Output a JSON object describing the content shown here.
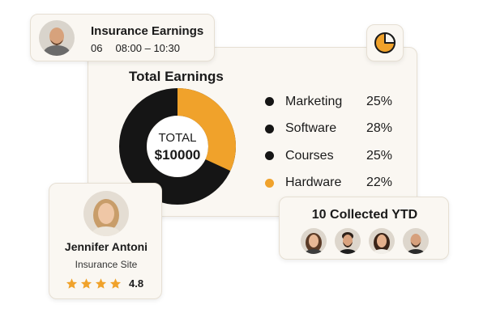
{
  "insurance_card": {
    "title": "Insurance Earnings",
    "day": "06",
    "time": "08:00 – 10:30",
    "avatar_icon": "bald-man-avatar-icon"
  },
  "earnings": {
    "title": "Total Earnings",
    "total_label": "TOTAL",
    "total_value": "$10000",
    "pie_icon": "pie-chart-icon",
    "colors": {
      "dark": "#151515",
      "accent": "#f0a22b"
    },
    "legend": [
      {
        "label": "Marketing",
        "pct": "25%",
        "color": "#151515"
      },
      {
        "label": "Software",
        "pct": "28%",
        "color": "#151515"
      },
      {
        "label": "Courses",
        "pct": "25%",
        "color": "#151515"
      },
      {
        "label": "Hardware",
        "pct": "22%",
        "color": "#f0a22b"
      }
    ]
  },
  "chart_data": {
    "type": "pie",
    "categories": [
      "Marketing",
      "Software",
      "Courses",
      "Hardware"
    ],
    "values": [
      25,
      28,
      25,
      22
    ],
    "title": "Total Earnings"
  },
  "person_card": {
    "name": "Jennifer Antoni",
    "subtitle": "Insurance Site",
    "stars": 4,
    "rating": "4.8",
    "avatar_icon": "woman-avatar-icon"
  },
  "collected_card": {
    "title": "10 Collected YTD",
    "avatars": [
      "woman-avatar-icon",
      "bearded-man-avatar-icon",
      "woman-avatar-icon",
      "bald-man-avatar-icon"
    ]
  }
}
